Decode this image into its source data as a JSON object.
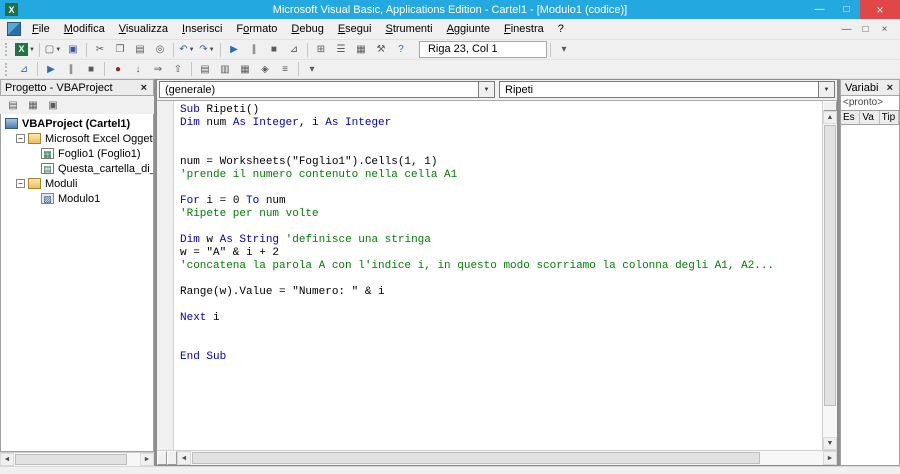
{
  "titlebar": {
    "title": "Microsoft Visual Basic, Applications Edition - Cartel1 - [Modulo1 (codice)]"
  },
  "menubar": {
    "items": [
      {
        "name": "menu-file",
        "label": "File",
        "u": 0
      },
      {
        "name": "menu-modifica",
        "label": "Modifica",
        "u": 0
      },
      {
        "name": "menu-visualizza",
        "label": "Visualizza",
        "u": 0
      },
      {
        "name": "menu-inserisci",
        "label": "Inserisci",
        "u": 0
      },
      {
        "name": "menu-formato",
        "label": "Formato",
        "u": 1
      },
      {
        "name": "menu-debug",
        "label": "Debug",
        "u": 0
      },
      {
        "name": "menu-esegui",
        "label": "Esegui",
        "u": 0
      },
      {
        "name": "menu-strumenti",
        "label": "Strumenti",
        "u": 0
      },
      {
        "name": "menu-aggiunte",
        "label": "Aggiunte",
        "u": 0
      },
      {
        "name": "menu-finestra",
        "label": "Finestra",
        "u": 0
      },
      {
        "name": "menu-help",
        "label": "?",
        "u": -1
      }
    ]
  },
  "toolbar_standard": {
    "position": "Riga 23, Col 1",
    "icons": [
      {
        "n": "view-excel-icon",
        "g": "X",
        "k": "excel",
        "cr": true
      },
      {
        "s": true
      },
      {
        "n": "insert-userform-icon",
        "g": "▢",
        "cr": true
      },
      {
        "n": "save-icon",
        "g": "▣",
        "c": "#3a5a9c"
      },
      {
        "s": true
      },
      {
        "n": "cut-icon",
        "g": "✂"
      },
      {
        "n": "copy-icon",
        "g": "❐"
      },
      {
        "n": "paste-icon",
        "g": "▤"
      },
      {
        "n": "find-icon",
        "g": "◎"
      },
      {
        "s": true
      },
      {
        "n": "undo-icon",
        "g": "↶",
        "c": "#3a5a9c",
        "cr": true
      },
      {
        "n": "redo-icon",
        "g": "↷",
        "c": "#3a5a9c",
        "cr": true
      },
      {
        "s": true
      },
      {
        "n": "run-icon",
        "g": "▶",
        "c": "#2b6cb8"
      },
      {
        "n": "break-icon",
        "g": "∥"
      },
      {
        "n": "reset-icon",
        "g": "■"
      },
      {
        "n": "design-mode-icon",
        "g": "⊿"
      },
      {
        "s": true
      },
      {
        "n": "project-explorer-icon",
        "g": "⊞"
      },
      {
        "n": "properties-window-icon",
        "g": "☰"
      },
      {
        "n": "object-browser-icon",
        "g": "▦"
      },
      {
        "n": "toolbox-icon",
        "g": "⚒"
      },
      {
        "n": "help-icon",
        "g": "?",
        "c": "#2b6cb8"
      },
      {
        "p": true
      },
      {
        "s": true
      },
      {
        "n": "toolbar-options-icon",
        "g": "▾"
      }
    ]
  },
  "toolbar_debug": {
    "icons": [
      {
        "n": "design-mode-icon",
        "g": "⊿",
        "c": "#3a6aa0"
      },
      {
        "s": true
      },
      {
        "n": "run-icon",
        "g": "▶",
        "c": "#2b6cb8"
      },
      {
        "n": "break-icon",
        "g": "∥"
      },
      {
        "n": "reset-icon",
        "g": "■"
      },
      {
        "s": true
      },
      {
        "n": "toggle-breakpoint-icon",
        "g": "●",
        "c": "#8a2a2a"
      },
      {
        "n": "step-into-icon",
        "g": "↓"
      },
      {
        "n": "step-over-icon",
        "g": "⇒"
      },
      {
        "n": "step-out-icon",
        "g": "⇧"
      },
      {
        "s": true
      },
      {
        "n": "locals-window-icon",
        "g": "▤"
      },
      {
        "n": "immediate-window-icon",
        "g": "▥"
      },
      {
        "n": "watch-window-icon",
        "g": "▦"
      },
      {
        "n": "quick-watch-icon",
        "g": "◈"
      },
      {
        "n": "call-stack-icon",
        "g": "≡"
      },
      {
        "s": true
      },
      {
        "n": "toolbar-overflow-icon",
        "g": "▾"
      }
    ]
  },
  "project_panel": {
    "title": "Progetto - VBAProject",
    "tools": [
      {
        "n": "view-code-icon",
        "g": "▤"
      },
      {
        "n": "view-object-icon",
        "g": "▦"
      },
      {
        "n": "toggle-folders-icon",
        "g": "▣"
      }
    ],
    "tree": [
      {
        "label": "VBAProject (Cartel1)",
        "level": 0,
        "icon": "project",
        "bold": true
      },
      {
        "label": "Microsoft Excel Oggetti",
        "level": 1,
        "icon": "folder",
        "exp": true
      },
      {
        "label": "Foglio1 (Foglio1)",
        "level": 2,
        "icon": "sheet"
      },
      {
        "label": "Questa_cartella_di_lavo",
        "level": 2,
        "icon": "workbook"
      },
      {
        "label": "Moduli",
        "level": 1,
        "icon": "folder",
        "exp": true
      },
      {
        "label": "Modulo1",
        "level": 2,
        "icon": "module"
      }
    ]
  },
  "code": {
    "object_dropdown": "(generale)",
    "procedure_dropdown": "Ripeti",
    "lines": [
      [
        [
          "k",
          "Sub"
        ],
        [
          "n",
          " Ripeti()"
        ]
      ],
      [
        [
          "k",
          "Dim"
        ],
        [
          "n",
          " num "
        ],
        [
          "k",
          "As Integer"
        ],
        [
          "n",
          ", i "
        ],
        [
          "k",
          "As Integer"
        ]
      ],
      [],
      [],
      [
        [
          "n",
          "num = Worksheets(\"Foglio1\").Cells(1, 1)"
        ]
      ],
      [
        [
          "c",
          "'prende il numero contenuto nella cella A1"
        ]
      ],
      [],
      [
        [
          "k",
          "For"
        ],
        [
          "n",
          " i = 0 "
        ],
        [
          "k",
          "To"
        ],
        [
          "n",
          " num"
        ]
      ],
      [
        [
          "c",
          "'Ripete per num volte"
        ]
      ],
      [],
      [
        [
          "k",
          "Dim"
        ],
        [
          "n",
          " w "
        ],
        [
          "k",
          "As String"
        ],
        [
          "n",
          " "
        ],
        [
          "c",
          "'definisce una stringa"
        ]
      ],
      [
        [
          "n",
          "w = \"A\" & i + 2"
        ]
      ],
      [
        [
          "c",
          "'concatena la parola A con l'indice i, in questo modo scorriamo la colonna degli A1, A2..."
        ]
      ],
      [],
      [
        [
          "n",
          "Range(w).Value = \"Numero: \" & i"
        ]
      ],
      [],
      [
        [
          "k",
          "Next"
        ],
        [
          "n",
          " i"
        ]
      ],
      [],
      [],
      [
        [
          "k",
          "End Sub"
        ]
      ]
    ]
  },
  "variables_panel": {
    "title": "Variabi",
    "status": "<pronto>",
    "columns": [
      "Es",
      "Va",
      "Tip"
    ]
  }
}
